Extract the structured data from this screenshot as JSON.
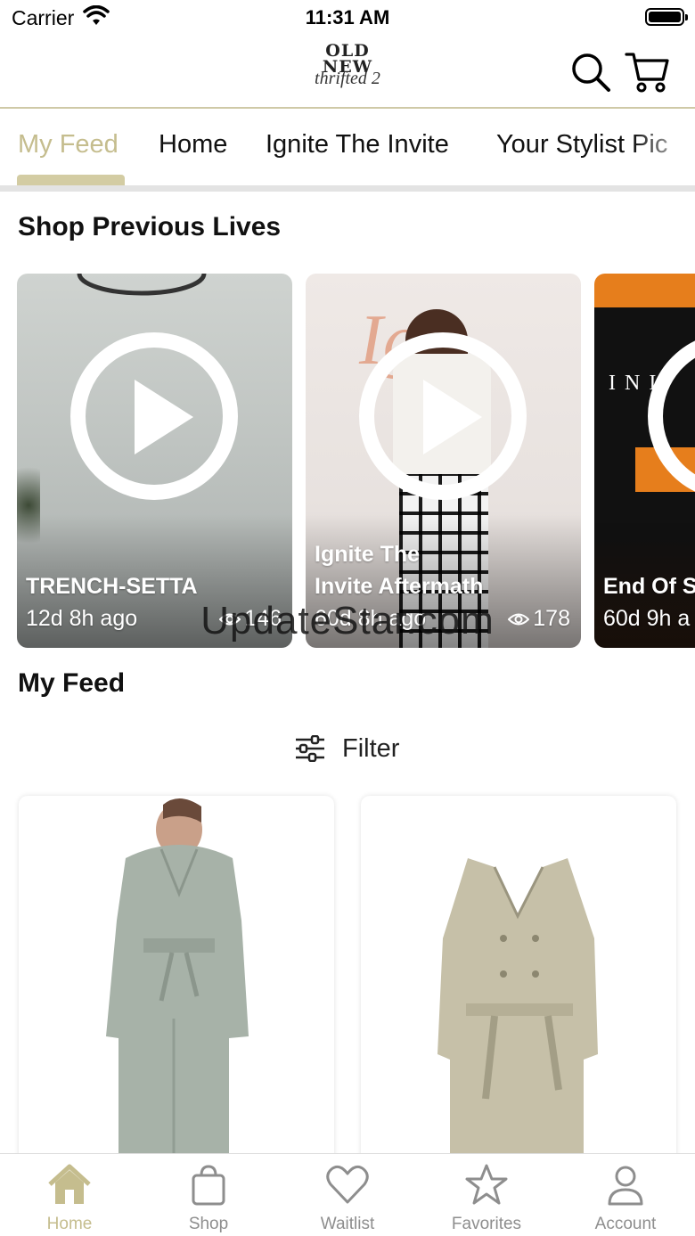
{
  "status_bar": {
    "carrier": "Carrier",
    "time": "11:31 AM"
  },
  "header": {
    "logo": {
      "line1": "OLD",
      "line2": "NEW",
      "line3": "thrifted 2"
    },
    "icons": [
      "search-icon",
      "cart-icon"
    ]
  },
  "tabs": [
    {
      "label": "My Feed",
      "active": true
    },
    {
      "label": "Home",
      "active": false
    },
    {
      "label": "Ignite The Invite",
      "active": false
    },
    {
      "label": "Your Stylist Pic",
      "active": false
    }
  ],
  "lives_section": {
    "title": "Shop Previous Lives",
    "items": [
      {
        "title_line1": "TRENCH-SETTA",
        "title_line2": "",
        "time": "12d 8h ago",
        "views": "146"
      },
      {
        "title_line1": "Ignite The",
        "title_line2": "Invite Aftermath",
        "time": "60d 8h ago",
        "views": "178"
      },
      {
        "title_line1": "End Of S",
        "title_line2": "",
        "time": "60d 9h a",
        "views": ""
      }
    ]
  },
  "watermark": "UpdateStar.com",
  "feed_section": {
    "title": "My Feed",
    "filter_label": "Filter",
    "products": [
      {
        "name": "sage-green-belted-jumpsuit"
      },
      {
        "name": "khaki-trench-coat"
      }
    ]
  },
  "bottom_nav": [
    {
      "label": "Home",
      "icon": "home-icon",
      "active": true
    },
    {
      "label": "Shop",
      "icon": "bag-icon",
      "active": false
    },
    {
      "label": "Waitlist",
      "icon": "heart-icon",
      "active": false
    },
    {
      "label": "Favorites",
      "icon": "star-icon",
      "active": false
    },
    {
      "label": "Account",
      "icon": "person-icon",
      "active": false
    }
  ],
  "colors": {
    "accent": "#c5bd8e",
    "inactive": "#8e8e8e"
  }
}
